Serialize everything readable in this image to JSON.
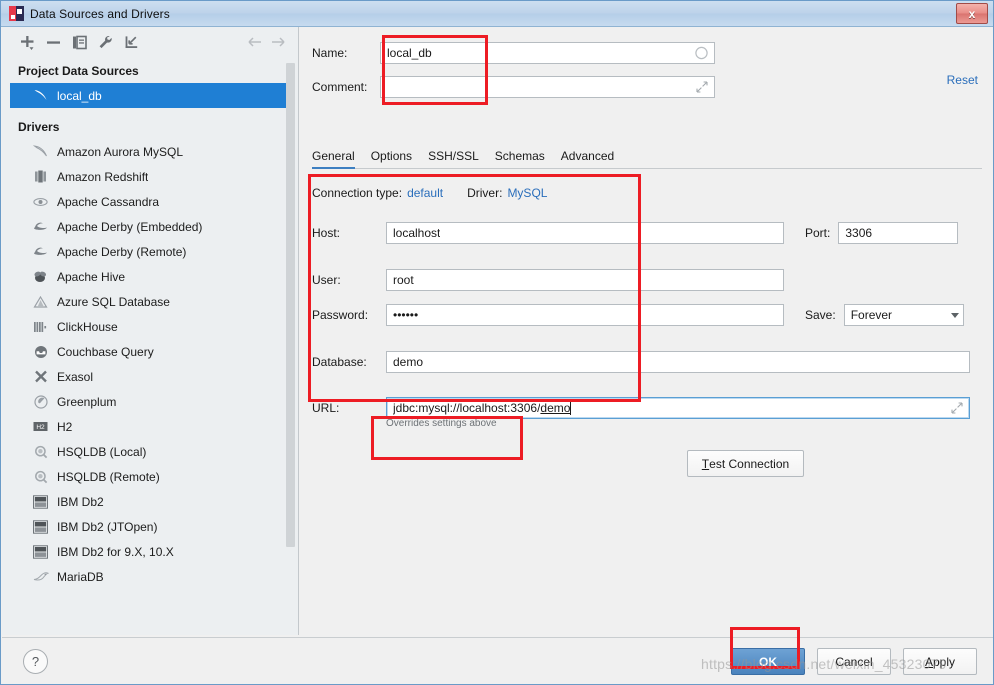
{
  "window": {
    "title": "Data Sources and Drivers",
    "app_icon": "intellij-datagrip-icon",
    "close_label": "x"
  },
  "toolbar": {
    "items": [
      {
        "name": "add-button",
        "icon": "plus-icon",
        "glyph": "+"
      },
      {
        "name": "remove-button",
        "icon": "minus-icon",
        "glyph": "−"
      },
      {
        "name": "duplicate-button",
        "icon": "copy-icon",
        "glyph": "❐"
      },
      {
        "name": "properties-button",
        "icon": "wrench-icon",
        "glyph": "🔧"
      },
      {
        "name": "import-button",
        "icon": "import-arrow-icon",
        "glyph": "↙"
      }
    ],
    "nav": [
      {
        "name": "back-button",
        "icon": "arrow-left-icon",
        "glyph": "←"
      },
      {
        "name": "forward-button",
        "icon": "arrow-right-icon",
        "glyph": "→"
      }
    ]
  },
  "sidebar": {
    "project_sources_header": "Project Data Sources",
    "project_sources": [
      {
        "label": "local_db",
        "icon": "mysql-dolphin-icon",
        "selected": true
      }
    ],
    "drivers_header": "Drivers",
    "drivers": [
      {
        "label": "Amazon Aurora MySQL",
        "icon": "mysql-dolphin-icon"
      },
      {
        "label": "Amazon Redshift",
        "icon": "redshift-icon"
      },
      {
        "label": "Apache Cassandra",
        "icon": "cassandra-eye-icon"
      },
      {
        "label": "Apache Derby (Embedded)",
        "icon": "derby-hat-icon"
      },
      {
        "label": "Apache Derby (Remote)",
        "icon": "derby-hat-icon"
      },
      {
        "label": "Apache Hive",
        "icon": "hive-bee-icon"
      },
      {
        "label": "Azure SQL Database",
        "icon": "azure-triangle-icon"
      },
      {
        "label": "ClickHouse",
        "icon": "clickhouse-bars-icon"
      },
      {
        "label": "Couchbase Query",
        "icon": "couchbase-icon"
      },
      {
        "label": "Exasol",
        "icon": "exasol-x-icon"
      },
      {
        "label": "Greenplum",
        "icon": "greenplum-icon"
      },
      {
        "label": "H2",
        "icon": "h2-icon"
      },
      {
        "label": "HSQLDB (Local)",
        "icon": "hsqldb-icon"
      },
      {
        "label": "HSQLDB (Remote)",
        "icon": "hsqldb-icon"
      },
      {
        "label": "IBM Db2",
        "icon": "ibm-db2-icon"
      },
      {
        "label": "IBM Db2 (JTOpen)",
        "icon": "ibm-db2-icon"
      },
      {
        "label": "IBM Db2 for 9.X, 10.X",
        "icon": "ibm-db2-icon"
      },
      {
        "label": "MariaDB",
        "icon": "mariadb-seal-icon"
      }
    ]
  },
  "form": {
    "name_label": "Name:",
    "name_value": "local_db",
    "comment_label": "Comment:",
    "comment_value": "",
    "reset_label": "Reset",
    "tabs": [
      {
        "label": "General",
        "active": true
      },
      {
        "label": "Options",
        "active": false
      },
      {
        "label": "SSH/SSL",
        "active": false
      },
      {
        "label": "Schemas",
        "active": false
      },
      {
        "label": "Advanced",
        "active": false
      }
    ],
    "connection_type_label": "Connection type:",
    "connection_type_value": "default",
    "driver_label": "Driver:",
    "driver_value": "MySQL",
    "host_label": "Host:",
    "host_value": "localhost",
    "port_label": "Port:",
    "port_value": "3306",
    "user_label": "User:",
    "user_value": "root",
    "password_label": "Password:",
    "password_value": "••••••",
    "save_label": "Save:",
    "save_value": "Forever",
    "database_label": "Database:",
    "database_value": "demo",
    "url_label": "URL:",
    "url_value": "jdbc:mysql://localhost:3306/",
    "url_value_underlined": "demo",
    "url_hint": "Overrides settings above",
    "test_connection_mnemonic": "T",
    "test_connection_label": "est Connection"
  },
  "footer": {
    "help_label": "?",
    "ok_label": "OK",
    "cancel_label": "Cancel",
    "apply_mnemonic": "A",
    "apply_label": "pply"
  },
  "watermark": "https://blog.csdn.net/weixin_45323079",
  "colors": {
    "selection_blue": "#1f7fd4",
    "link_blue": "#2a6ebb",
    "annotation_red": "#ed1c24",
    "primary_button": "#4a83bd"
  }
}
